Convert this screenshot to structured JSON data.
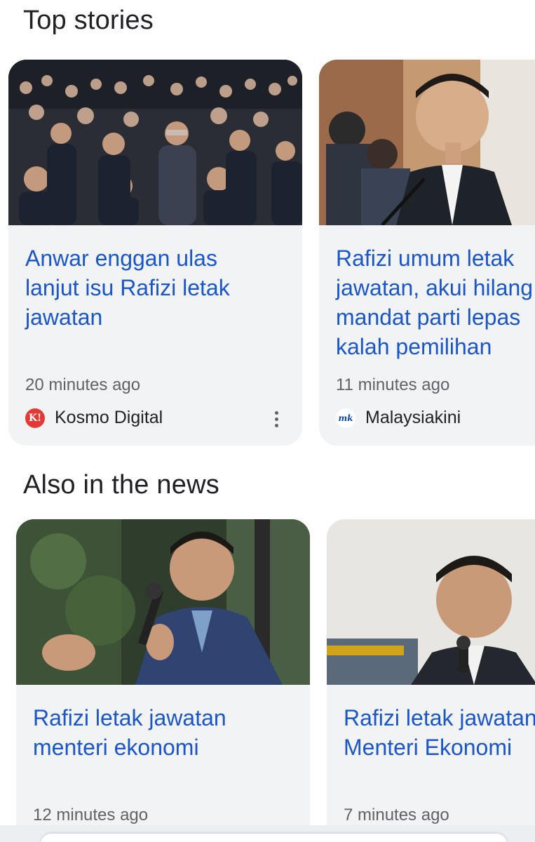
{
  "top_stories": {
    "title": "Top stories",
    "cards": [
      {
        "image": "crowd-photo",
        "headline_lines": [
          "Anwar enggan ulas",
          "lanjut isu Rafizi letak",
          "jawatan"
        ],
        "time": "20 minutes ago",
        "source": "Kosmo Digital",
        "source_logo": "K!",
        "source_logo_color": "#e53935"
      },
      {
        "image": "speaker-podium-photo",
        "headline_lines": [
          "Rafizi umum letak",
          "jawatan, akui hilang",
          "mandat parti lepas",
          "kalah pemilihan"
        ],
        "time": "11 minutes ago",
        "source": "Malaysiakini",
        "source_logo": "mk",
        "source_logo_color": "#0d47a1"
      }
    ]
  },
  "also_in_news": {
    "title": "Also in the news",
    "cards": [
      {
        "image": "speaker-microphone-photo",
        "headline_lines": [
          "Rafizi letak jawatan",
          "menteri ekonomi"
        ],
        "time": "12 minutes ago"
      },
      {
        "image": "speaker-closeup-photo",
        "headline_lines": [
          "Rafizi letak jawatan",
          "Menteri Ekonomi"
        ],
        "time": "7 minutes ago"
      }
    ]
  },
  "icons": {
    "more": "more-vert-icon"
  }
}
